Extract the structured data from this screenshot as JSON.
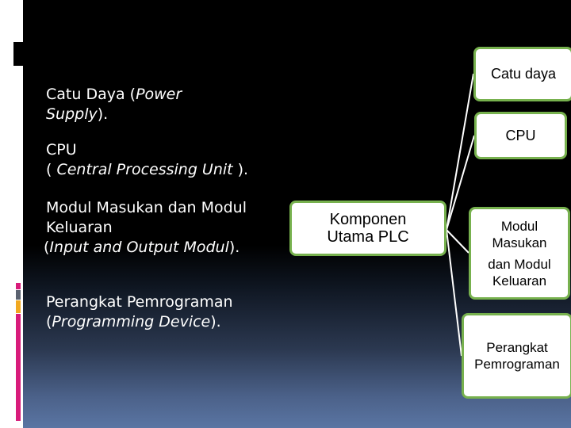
{
  "slide": {
    "colors": {
      "background_top": "#000000",
      "background_bottom": "#5a75a3",
      "node_border": "#77b14e",
      "node_fill": "#ffffff",
      "connector": "#ffffff",
      "accent_pink": "#d81b7a",
      "accent_gray": "#5b6270",
      "accent_orange": "#f1a820"
    }
  },
  "bullets": [
    {
      "marker": ".",
      "lines": [
        {
          "normal": "Catu Daya (",
          "italic": "Power",
          "after": ""
        },
        {
          "normal": "",
          "italic": "Supply",
          "after": ")."
        }
      ]
    },
    {
      "marker": ".",
      "lines": [
        {
          "normal": "CPU",
          "italic": "",
          "after": ""
        },
        {
          "normal": "( ",
          "italic": "Central Processing Unit",
          "after": " )."
        }
      ]
    },
    {
      "marker": ".",
      "lines": [
        {
          "normal": "Modul Masukan dan Modul",
          "italic": "",
          "after": ""
        },
        {
          "normal": "Keluaran",
          "italic": "",
          "after": ""
        },
        {
          "normal": "(",
          "italic": "Input and Output Modul",
          "after": ")."
        }
      ]
    },
    {
      "marker": ".",
      "lines": [
        {
          "normal": "Perangkat Pemrograman",
          "italic": "",
          "after": ""
        },
        {
          "normal": "(",
          "italic": "Programming Device",
          "after": ")."
        }
      ]
    }
  ],
  "diagram": {
    "center": {
      "lines": [
        "Komponen",
        "Utama PLC"
      ]
    },
    "nodes": [
      {
        "id": "catu",
        "lines": [
          "Catu daya"
        ]
      },
      {
        "id": "cpu",
        "lines": [
          "CPU"
        ]
      },
      {
        "id": "modul",
        "lines": [
          "Modul",
          "Masukan",
          "dan Modul",
          "Keluaran"
        ]
      },
      {
        "id": "perangkat",
        "lines": [
          "Perangkat",
          "Pemrograman"
        ]
      }
    ]
  }
}
